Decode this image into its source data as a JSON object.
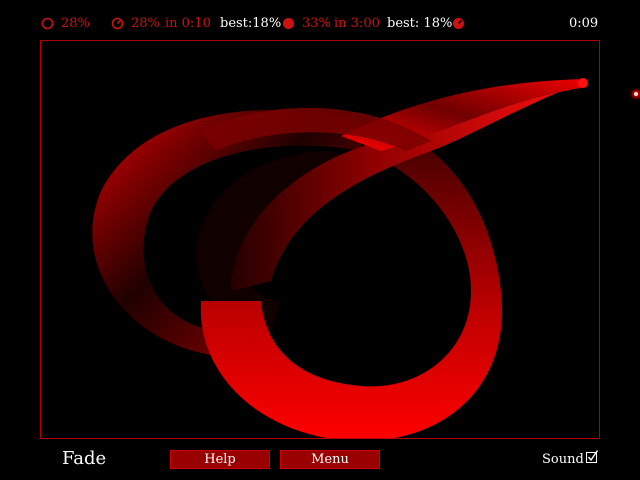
{
  "hud": {
    "current_pct": "28%",
    "timed_pct": "28%",
    "timed_time": "in 0:10",
    "timed_best": "best:18%",
    "goal_pct": "33%",
    "goal_time": "in 3:00",
    "goal_best": "best: 18%",
    "timer": "0:09"
  },
  "level": {
    "name": "Fade"
  },
  "buttons": {
    "help": "Help",
    "menu": "Menu"
  },
  "sound": {
    "label": "Sound",
    "checked": true
  },
  "colors": {
    "accent": "#cc1111",
    "border": "#b00000",
    "button_bg": "#990000"
  },
  "icons": [
    "empty-circle-icon",
    "clock-icon",
    "filled-circle-icon",
    "clock-check-icon",
    "checkbox-icon"
  ]
}
